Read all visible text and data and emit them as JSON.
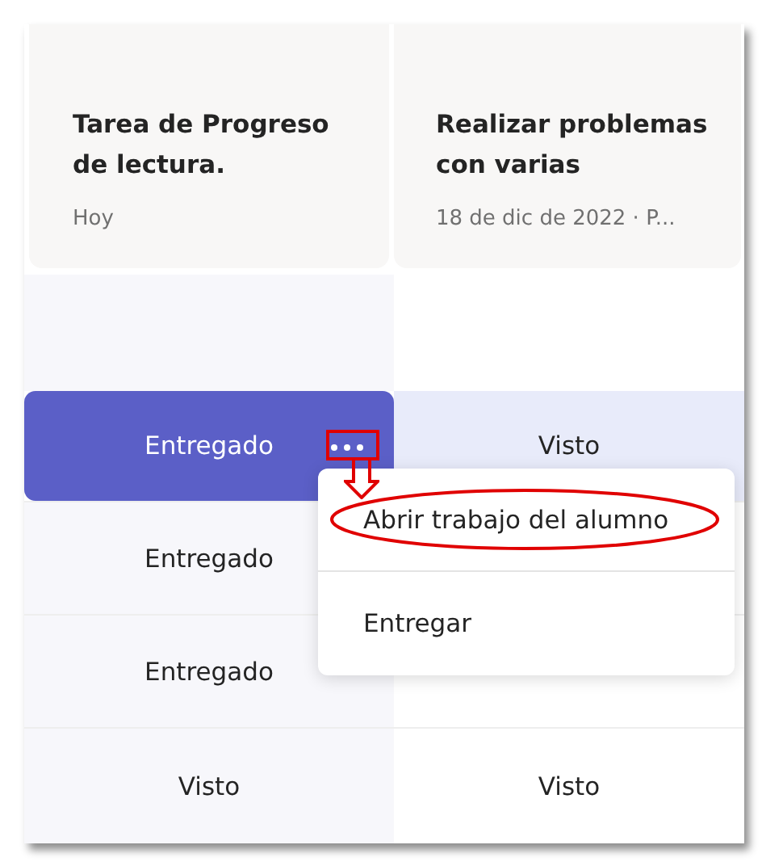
{
  "columns": [
    {
      "title": "Tarea de Progreso de lectura.",
      "subtitle": "Hoy"
    },
    {
      "title": "Realizar problemas con varias",
      "subtitle": "18 de dic de 2022 · P..."
    }
  ],
  "rows": [
    {
      "selected": true,
      "cells": [
        "Entregado",
        "Visto"
      ]
    },
    {
      "selected": false,
      "cells": [
        "Entregado"
      ]
    },
    {
      "selected": false,
      "cells": [
        "Entregado"
      ]
    },
    {
      "selected": false,
      "cells": [
        "Visto",
        "Visto"
      ]
    }
  ],
  "menu": {
    "items": [
      {
        "label": "Abrir trabajo del alumno",
        "annotated": true
      },
      {
        "label": "Entregar",
        "annotated": false
      }
    ]
  }
}
